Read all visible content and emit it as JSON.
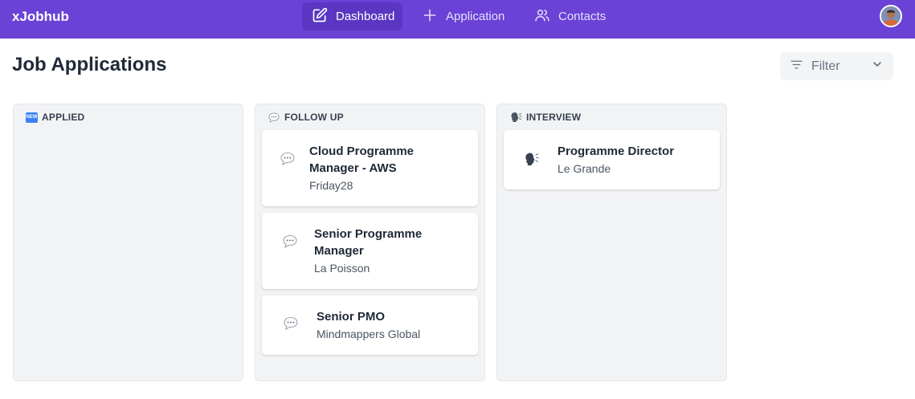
{
  "app": {
    "brand": "xJobhub"
  },
  "nav": {
    "dashboard": "Dashboard",
    "application": "Application",
    "contacts": "Contacts"
  },
  "page": {
    "title": "Job Applications"
  },
  "filter": {
    "label": "Filter"
  },
  "columns": [
    {
      "title": "APPLIED",
      "icon": "new-badge-icon",
      "cards": []
    },
    {
      "title": "FOLLOW UP",
      "icon": "speech-bubble-icon",
      "cards": [
        {
          "title": "Cloud Programme Manager - AWS",
          "company": "Friday28"
        },
        {
          "title": "Senior Programme Manager",
          "company": "La Poisson"
        },
        {
          "title": "Senior PMO",
          "company": "Mindmappers Global"
        }
      ]
    },
    {
      "title": "INTERVIEW",
      "icon": "speaking-head-icon",
      "cards": [
        {
          "title": "Programme Director",
          "company": "Le Grande"
        }
      ]
    }
  ],
  "colors": {
    "topbar": "#6a42d6",
    "topbar_active": "#5a36c2",
    "column_bg": "#f2f3f5",
    "card_bg": "#ffffff"
  }
}
